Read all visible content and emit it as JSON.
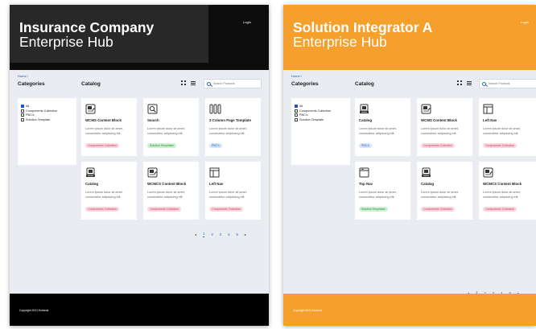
{
  "screens": [
    {
      "brand_title": "Insurance Company",
      "brand_subtitle": "Enterprise Hub",
      "login": "Login",
      "breadcrumb": "Home /",
      "categories_heading": "Categories",
      "catalog_heading": "Catalog",
      "search_placeholder": "Search Products",
      "categories": [
        "All",
        "Components Collection",
        "PBC's",
        "Solution Template"
      ],
      "cards": [
        {
          "title": "WCMS Content Block",
          "desc": "Lorem ipsum dolor sit amet, consectetur adipiscing elit.",
          "badge": "Components Collection",
          "icon": "content-block-icon"
        },
        {
          "title": "Search",
          "desc": "Lorem ipsum dolor sit amet, consectetur adipiscing elit.",
          "badge": "Solution Templates",
          "icon": "search-page-icon"
        },
        {
          "title": "3 Column Page Template",
          "desc": "Lorem ipsum dolor sit amet, consectetur adipiscing elit.",
          "badge": "PBC's",
          "icon": "three-column-icon"
        },
        {
          "title": "Catalog",
          "desc": "Lorem ipsum dolor sit amet, consectetur adipiscing elit.",
          "badge": "Components Collection",
          "icon": "catalog-icon"
        },
        {
          "title": "WCMCS Content Block",
          "desc": "Lorem ipsum dolor sit amet, consectetur adipiscing elit.",
          "badge": "Components Collection",
          "icon": "content-block-icon"
        },
        {
          "title": "Left Nav",
          "desc": "Lorem ipsum dolor sit amet, consectetur adipiscing elit.",
          "badge": "Components Collection",
          "icon": "left-nav-icon"
        }
      ],
      "pages": [
        "1",
        "2",
        "3",
        "4",
        "5"
      ],
      "copyright": "Copyright 2021 Embeds"
    },
    {
      "brand_title": "Solution Integrator A",
      "brand_subtitle": "Enterprise Hub",
      "login": "Login",
      "breadcrumb": "Home /",
      "categories_heading": "Categories",
      "catalog_heading": "Catalog",
      "search_placeholder": "Search Products",
      "categories": [
        "All",
        "Components Collection",
        "PBC's",
        "Solution Template"
      ],
      "cards": [
        {
          "title": "Catalog",
          "desc": "Lorem ipsum dolor sit amet, consectetur adipiscing elit.",
          "badge": "PBC's",
          "icon": "catalog-icon"
        },
        {
          "title": "WCMS Content Block",
          "desc": "Lorem ipsum dolor sit amet, consectetur adipiscing elit.",
          "badge": "Components Collection",
          "icon": "content-block-icon"
        },
        {
          "title": "Left Nav",
          "desc": "Lorem ipsum dolor sit amet, consectetur adipiscing elit.",
          "badge": "Components Collection",
          "icon": "left-nav-icon"
        },
        {
          "title": "Top Nav",
          "desc": "Lorem ipsum dolor sit amet, consectetur adipiscing elit.",
          "badge": "Solution Templates",
          "icon": "top-nav-icon"
        },
        {
          "title": "Catalog",
          "desc": "Lorem ipsum dolor sit amet, consectetur adipiscing elit.",
          "badge": "Components Collection",
          "icon": "catalog-icon"
        },
        {
          "title": "WCMCS Content Block",
          "desc": "Lorem ipsum dolor sit amet, consectetur adipiscing elit.",
          "badge": "Components Collection",
          "icon": "content-block-icon"
        }
      ],
      "pages": [
        "1",
        "2",
        "3",
        "4",
        "5"
      ],
      "copyright": "Copyright 2021 Embeds"
    }
  ],
  "colors": {
    "dark_header": "#0d0d0d",
    "orange_theme": "#f5a02c",
    "link_blue": "#1a56c4"
  }
}
